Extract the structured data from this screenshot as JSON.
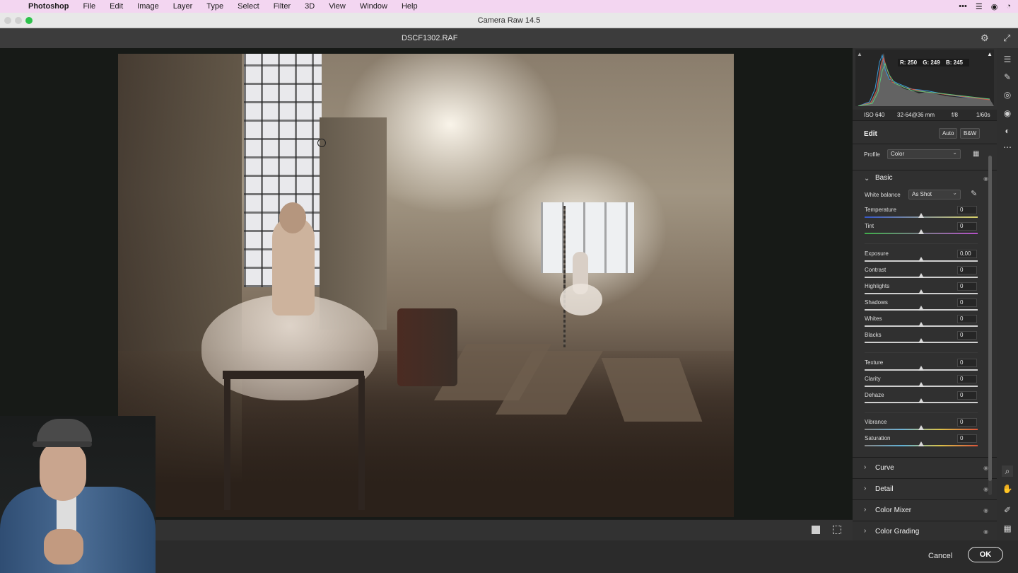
{
  "menubar": {
    "app": "Photoshop",
    "items": [
      "File",
      "Edit",
      "Image",
      "Layer",
      "Type",
      "Select",
      "Filter",
      "3D",
      "View",
      "Window",
      "Help"
    ]
  },
  "window": {
    "title": "Camera Raw 14.5"
  },
  "file": {
    "name": "DSCF1302.RAF"
  },
  "histogram": {
    "r": "R: 250",
    "g": "G: 249",
    "b": "B: 245"
  },
  "exif": {
    "iso": "ISO 640",
    "lens": "32-64@36 mm",
    "aperture": "f/8",
    "shutter": "1/60s"
  },
  "edit": {
    "title": "Edit",
    "auto_label": "Auto",
    "bw_label": "B&W",
    "profile_label": "Profile",
    "profile_value": "Color",
    "basic_title": "Basic",
    "wb_label": "White balance",
    "wb_value": "As Shot",
    "sliders": [
      {
        "name": "Temperature",
        "value": "0"
      },
      {
        "name": "Tint",
        "value": "0"
      },
      {
        "name": "Exposure",
        "value": "0,00"
      },
      {
        "name": "Contrast",
        "value": "0"
      },
      {
        "name": "Highlights",
        "value": "0"
      },
      {
        "name": "Shadows",
        "value": "0"
      },
      {
        "name": "Whites",
        "value": "0"
      },
      {
        "name": "Blacks",
        "value": "0"
      },
      {
        "name": "Texture",
        "value": "0"
      },
      {
        "name": "Clarity",
        "value": "0"
      },
      {
        "name": "Dehaze",
        "value": "0"
      },
      {
        "name": "Vibrance",
        "value": "0"
      },
      {
        "name": "Saturation",
        "value": "0"
      }
    ],
    "sections": [
      "Curve",
      "Detail",
      "Color Mixer",
      "Color Grading"
    ]
  },
  "footer": {
    "cancel": "Cancel",
    "ok": "OK"
  },
  "icons": {
    "settings": "gear-icon",
    "fullscreen": "expand-icon",
    "tools": [
      "edit-sliders-icon",
      "healing-brush-icon",
      "masking-icon",
      "red-eye-icon",
      "presets-icon",
      "more-icon",
      "zoom-icon",
      "hand-icon",
      "color-sampler-icon",
      "grid-icon"
    ]
  },
  "colors": {
    "accent_ok_border": "#e6e6e6",
    "menubar_bg": "#f3d6f1"
  }
}
